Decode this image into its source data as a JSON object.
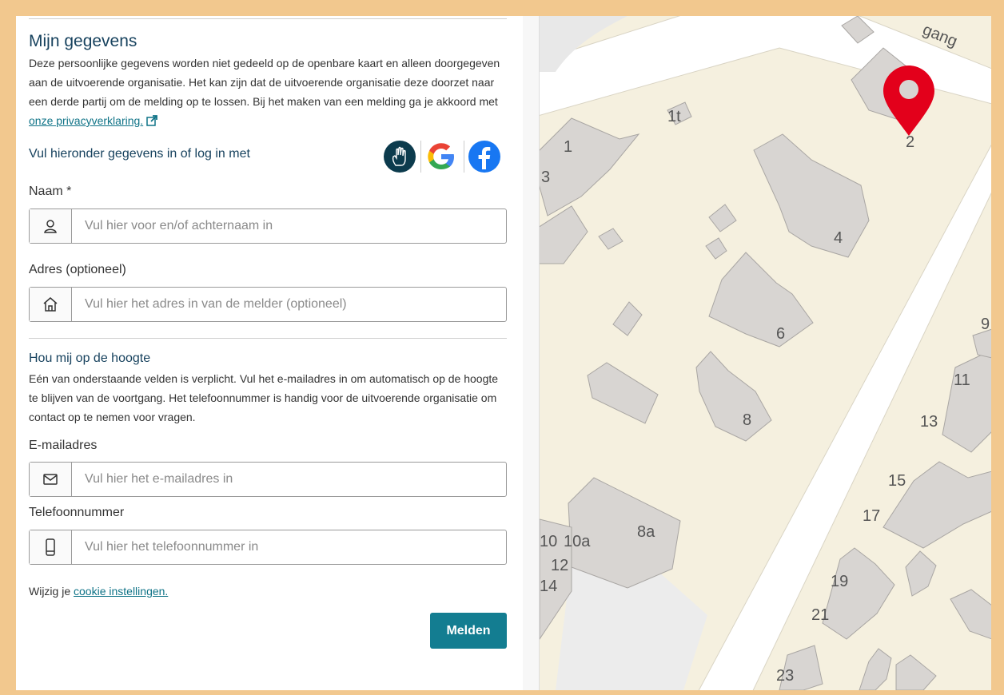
{
  "form": {
    "title": "Mijn gegevens",
    "privacy_text": "Deze persoonlijke gegevens worden niet gedeeld op de openbare kaart en alleen doorgegeven aan de uitvoerende organisatie. Het kan zijn dat de uitvoerende organisatie deze doorzet naar een derde partij om de melding op te lossen. Bij het maken van een melding ga je akkoord met",
    "privacy_link": "onze privacyverklaring.",
    "login_label": "Vul hieronder gegevens in of log in met",
    "login_providers": [
      "hand-login-icon",
      "google-icon",
      "facebook-icon"
    ],
    "name": {
      "label": "Naam *",
      "placeholder": "Vul hier voor en/of achternaam in",
      "value": "",
      "icon": "user-icon"
    },
    "address": {
      "label": "Adres (optioneel)",
      "placeholder": "Vul hier het adres in van de melder (optioneel)",
      "value": "",
      "icon": "home-icon"
    },
    "updates": {
      "title": "Hou mij op de hoogte",
      "text": "Eén van onderstaande velden is verplicht. Vul het e-mailadres in om automatisch op de hoogte te blijven van de voortgang. Het telefoonnummer is handig voor de uitvoerende organisatie om contact op te nemen voor vragen."
    },
    "email": {
      "label": "E-mailadres",
      "placeholder": "Vul hier het e-mailadres in",
      "value": "",
      "icon": "mail-icon"
    },
    "phone": {
      "label": "Telefoonnummer",
      "placeholder": "Vul hier het telefoonnummer in",
      "value": "",
      "icon": "phone-icon"
    },
    "cookie_prefix": "Wijzig je",
    "cookie_link": "cookie instellingen.",
    "submit_label": "Melden"
  },
  "map": {
    "street_label": "gang",
    "house_numbers": [
      "1",
      "1t",
      "2",
      "3",
      "4",
      "6",
      "8",
      "8a",
      "9",
      "10",
      "10a",
      "11",
      "12",
      "13",
      "14",
      "15",
      "17",
      "19",
      "21",
      "23"
    ],
    "marker_color": "#e3001b"
  },
  "colors": {
    "accent": "#137d91",
    "heading": "#17425e",
    "frame": "#f2c88e"
  }
}
